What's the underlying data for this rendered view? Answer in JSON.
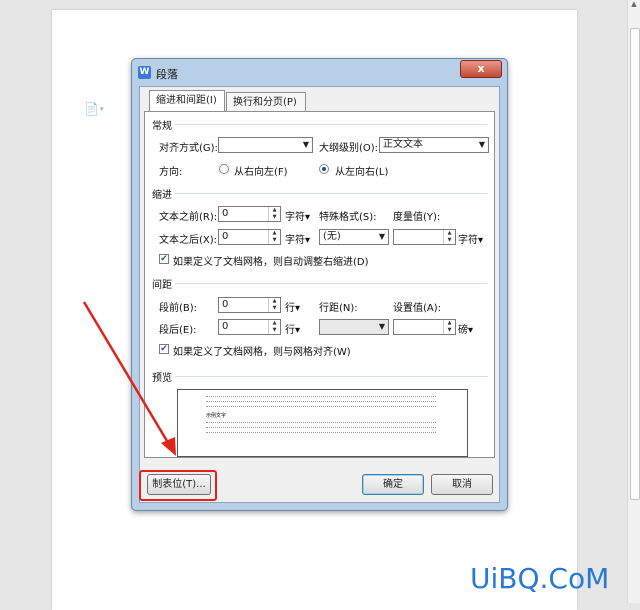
{
  "dialog": {
    "title": "段落",
    "close_label": "x",
    "tabs": [
      {
        "label": "缩进和间距(I)"
      },
      {
        "label": "换行和分页(P)"
      }
    ],
    "general": {
      "section": "常规",
      "align_label": "对齐方式(G):",
      "align_value": "",
      "outline_label": "大纲级别(O):",
      "outline_value": "正文文本",
      "direction_label": "方向:",
      "rtl_label": "从右向左(F)",
      "ltr_label": "从左向右(L)",
      "direction_selected": "ltr"
    },
    "indent": {
      "section": "缩进",
      "before_label": "文本之前(R):",
      "before_value": "0",
      "before_unit": "字符▾",
      "after_label": "文本之后(X):",
      "after_value": "0",
      "after_unit": "字符▾",
      "special_label": "特殊格式(S):",
      "special_value": "(无)",
      "measure_label": "度量值(Y):",
      "measure_value": "",
      "measure_unit": "字符▾",
      "grid_check_label": "如果定义了文档网格，则自动调整右缩进(D)",
      "grid_checked": true
    },
    "spacing": {
      "section": "间距",
      "before_label": "段前(B):",
      "before_value": "0",
      "before_unit": "行▾",
      "after_label": "段后(E):",
      "after_value": "0",
      "after_unit": "行▾",
      "line_label": "行距(N):",
      "line_value": "",
      "setting_label": "设置值(A):",
      "setting_value": "",
      "setting_unit": "磅▾",
      "grid_check_label": "如果定义了文档网格，则与网格对齐(W)",
      "grid_checked": true
    },
    "preview": {
      "section": "预览",
      "sample_label": "示例文字"
    },
    "buttons": {
      "tabs_label": "制表位(T)...",
      "ok_label": "确定",
      "cancel_label": "取消"
    }
  },
  "watermark": "UiBQ.CoM",
  "colors": {
    "highlight": "#e2231a",
    "watermark": "#2878d9",
    "dialog_frame": "#b8cfe8"
  }
}
